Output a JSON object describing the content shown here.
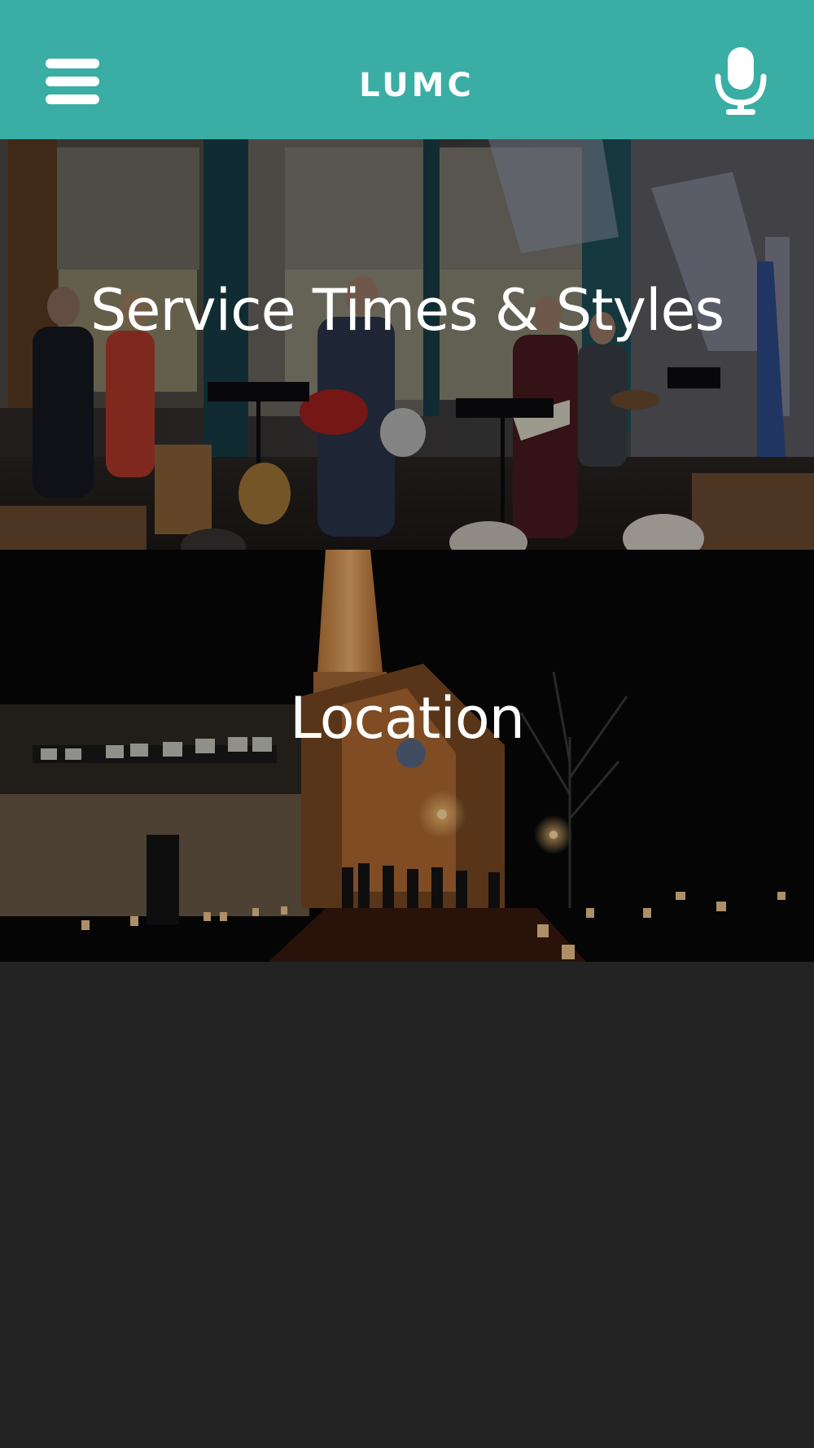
{
  "header": {
    "title": "LUMC",
    "background_color": "#3aada4",
    "menu_icon": "hamburger-menu-icon",
    "mic_icon": "microphone-icon"
  },
  "tiles": [
    {
      "label": "Service Times & Styles",
      "image": "worship-band-photo"
    },
    {
      "label": "Location",
      "image": "church-at-night-photo"
    }
  ],
  "page_background": "#232323"
}
